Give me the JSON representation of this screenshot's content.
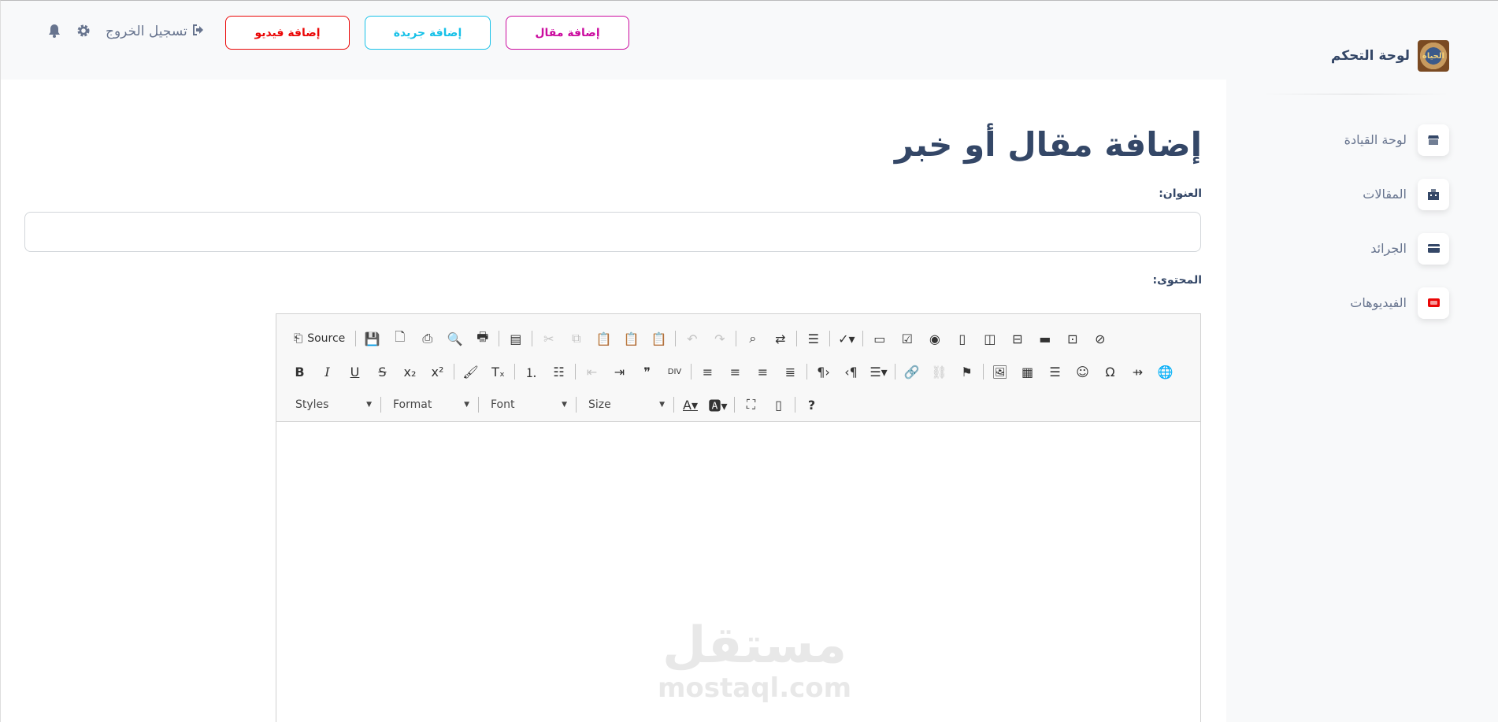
{
  "sidebar": {
    "brand_title": "لوحة التحكم",
    "brand_logo_text": "الحياة",
    "items": [
      {
        "label": "لوحة القيادة",
        "icon": "shop-icon"
      },
      {
        "label": "المقالات",
        "icon": "office-icon"
      },
      {
        "label": "الجرائد",
        "icon": "credit-card-icon"
      },
      {
        "label": "الفيديوهات",
        "icon": "video-icon"
      }
    ]
  },
  "topbar": {
    "add_article": "إضافة مقال",
    "add_paper": "إضافة جريدة",
    "add_video": "إضافة فيديو",
    "logout": "تسجيل الخروج"
  },
  "form": {
    "page_title": "إضافة مقال أو خبر",
    "title_label": "العنوان:",
    "title_value": "",
    "content_label": "المحتوى:"
  },
  "editor": {
    "source_label": "Source",
    "styles_label": "Styles",
    "format_label": "Format",
    "font_label": "Font",
    "size_label": "Size"
  },
  "watermark": {
    "line1": "مستقل",
    "line2": "mostaql.com"
  },
  "colors": {
    "primary": "#cb0c9f",
    "info": "#17c1e8",
    "danger": "#ea0606",
    "heading": "#344767",
    "muted": "#67748e"
  }
}
